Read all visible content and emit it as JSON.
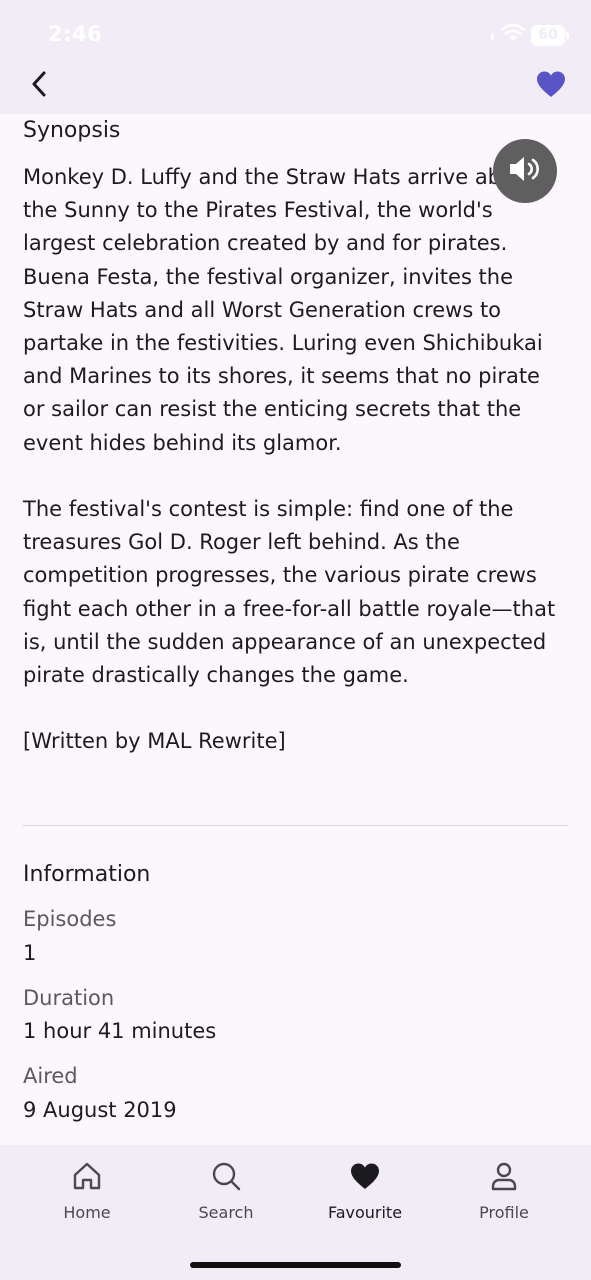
{
  "status_bar": {
    "time": "2:46",
    "battery": "60",
    "icons": [
      "signal-icon",
      "wifi-icon",
      "battery-icon"
    ]
  },
  "header": {
    "back_icon": "chevron-left-icon",
    "favourite_icon": "heart-icon",
    "accent_color": "#5a55c7"
  },
  "synopsis": {
    "heading": "Synopsis",
    "text": "Monkey D. Luffy and the Straw Hats arrive aboard the Sunny to the Pirates Festival, the world's largest celebration created by and for pirates. Buena Festa, the festival organizer, invites the Straw Hats and all Worst Generation crews to partake in the festivities. Luring even Shichibukai and Marines to its shores, it seems that no pirate or sailor can resist the enticing secrets that the event hides behind its glamor.\n\nThe festival's contest is simple: find one of the treasures Gol D. Roger left behind. As the competition progresses, the various pirate crews fight each other in a free-for-all battle royale—that is, until the sudden appearance of an unexpected pirate drastically changes the game.\n\n[Written by MAL Rewrite]",
    "speak_icon": "volume-icon"
  },
  "information": {
    "heading": "Information",
    "fields": [
      {
        "label": "Episodes",
        "value": "1"
      },
      {
        "label": "Duration",
        "value": "1 hour 41 minutes"
      },
      {
        "label": "Aired",
        "value": "9 August 2019"
      }
    ]
  },
  "bottom_nav": {
    "items": [
      {
        "label": "Home",
        "icon": "home-icon",
        "active": false
      },
      {
        "label": "Search",
        "icon": "search-icon",
        "active": false
      },
      {
        "label": "Favourite",
        "icon": "heart-icon",
        "active": true
      },
      {
        "label": "Profile",
        "icon": "user-icon",
        "active": false
      }
    ]
  }
}
